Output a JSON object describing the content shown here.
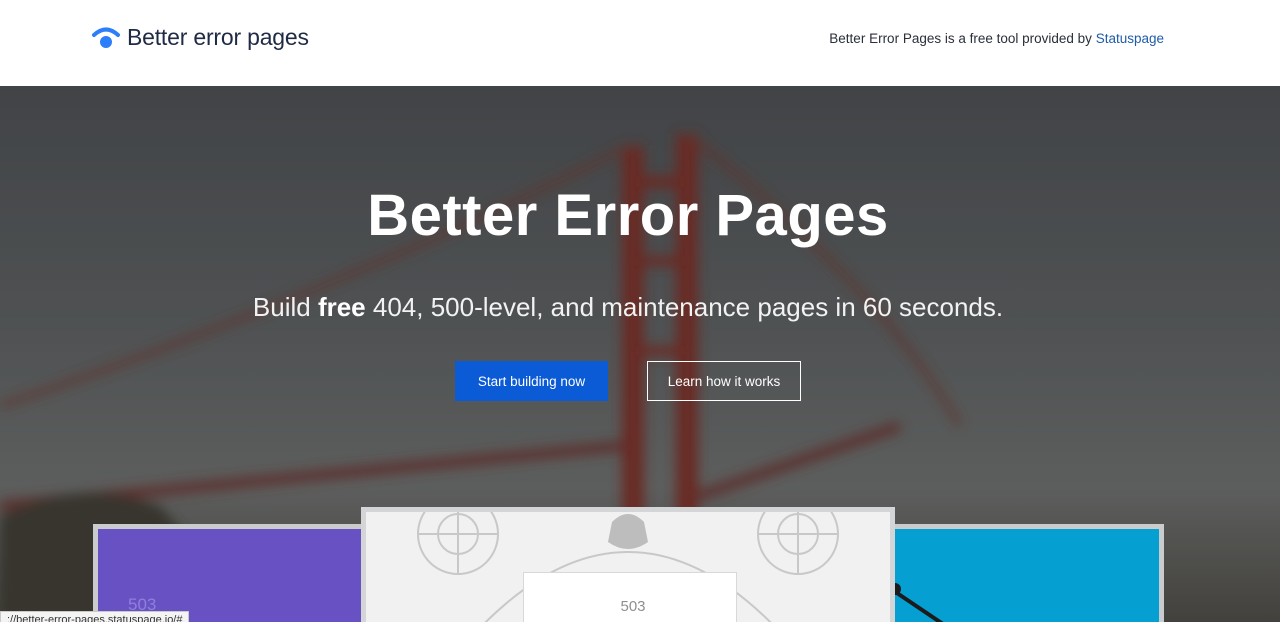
{
  "header": {
    "brand_name": "Better error pages",
    "provided_text": "Better Error Pages is a free tool provided by ",
    "provided_link": "Statuspage",
    "logo_color": "#2d7ff9"
  },
  "hero": {
    "title": "Better Error Pages",
    "subtitle_before": "Build ",
    "subtitle_bold": "free",
    "subtitle_after": " 404, 500-level, and maintenance pages in 60 seconds.",
    "primary_button": "Start building now",
    "secondary_button": "Learn how it works",
    "primary_color": "#0b5ad6"
  },
  "previews": {
    "left_code": "503",
    "middle_code": "503",
    "left_color": "#6751c3",
    "right_color": "#069fd1"
  },
  "status_bar": {
    "url": "://better-error-pages.statuspage.io/#"
  }
}
